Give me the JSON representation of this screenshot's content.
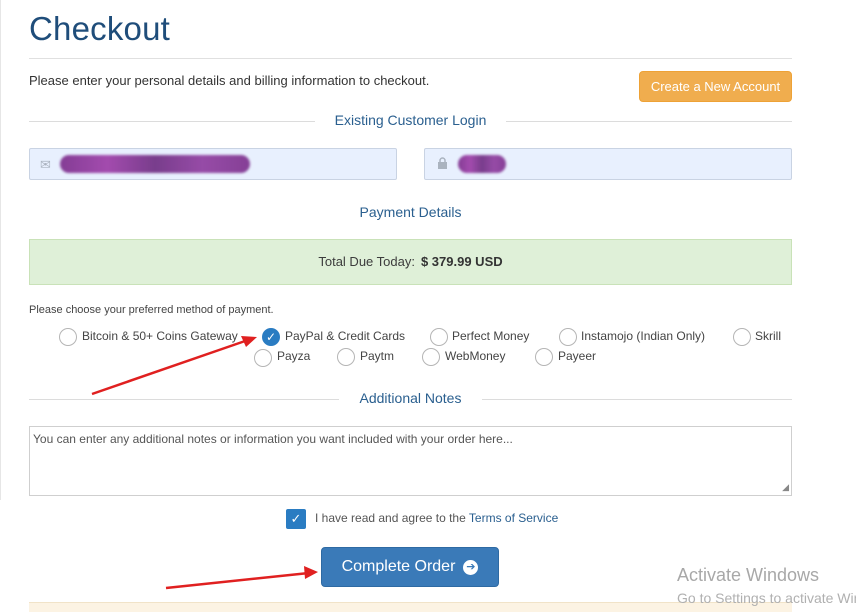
{
  "header": {
    "title": "Checkout",
    "intro": "Please enter your personal details and billing information to checkout.",
    "create_account_label": "Create a New Account"
  },
  "login": {
    "heading": "Existing Customer Login",
    "email_icon": "envelope-icon",
    "password_icon": "lock-icon"
  },
  "payment": {
    "heading": "Payment Details",
    "total_label": "Total Due Today:",
    "total_value": "$ 379.99 USD",
    "choose_text": "Please choose your preferred method of payment.",
    "methods": [
      {
        "label": "Bitcoin & 50+ Coins Gateway",
        "checked": false
      },
      {
        "label": "PayPal & Credit Cards",
        "checked": true
      },
      {
        "label": "Perfect Money",
        "checked": false
      },
      {
        "label": "Instamojo (Indian Only)",
        "checked": false
      },
      {
        "label": "Skrill",
        "checked": false
      },
      {
        "label": "Payza",
        "checked": false
      },
      {
        "label": "Paytm",
        "checked": false
      },
      {
        "label": "WebMoney",
        "checked": false
      },
      {
        "label": "Payeer",
        "checked": false
      }
    ]
  },
  "notes": {
    "heading": "Additional Notes",
    "placeholder": "You can enter any additional notes or information you want included with your order here..."
  },
  "agreement": {
    "checked": true,
    "text": "I have read and agree to the",
    "link": "Terms of Service"
  },
  "complete_label": "Complete Order",
  "watermark": {
    "line1": "Activate Windows",
    "line2": "Go to Settings to activate Windows."
  },
  "colors": {
    "title": "#1f4d7a",
    "create_button": "#f0ad4e",
    "total_bg": "#dff0d8",
    "primary": "#3a7ab8",
    "annotation_arrow": "#e02020"
  }
}
